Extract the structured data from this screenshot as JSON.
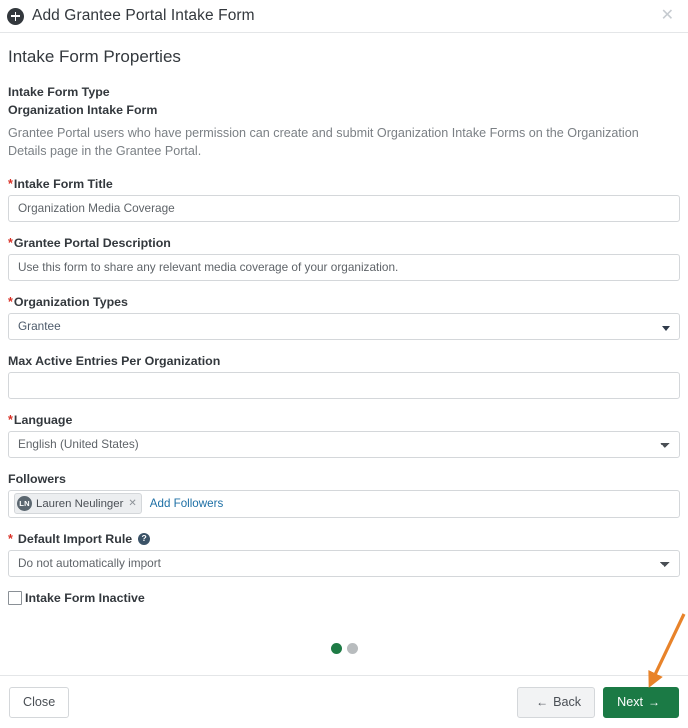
{
  "header": {
    "icon": "add-circle-icon",
    "title": "Add Grantee Portal Intake Form",
    "close_label": "✕"
  },
  "body": {
    "section_title": "Intake Form Properties",
    "intake_form_type": {
      "label": "Intake Form Type",
      "value": "Organization Intake Form",
      "description": "Grantee Portal users who have permission can create and submit Organization Intake Forms on the Organization Details page in the Grantee Portal."
    },
    "fields": {
      "intake_form_title": {
        "label": "Intake Form Title",
        "required": true,
        "required_marker": "*",
        "value": "Organization Media Coverage",
        "placeholder": ""
      },
      "grantee_portal_description": {
        "label": "Grantee Portal Description",
        "required": true,
        "required_marker": "*",
        "value": "Use this form to share any relevant media coverage of your organization.",
        "placeholder": ""
      },
      "organization_types": {
        "label": "Organization Types",
        "required": true,
        "required_marker": "*",
        "value": "Grantee",
        "caret": "caret-down-icon"
      },
      "max_active_entries": {
        "label": "Max Active Entries Per Organization",
        "required": false,
        "value": "",
        "placeholder": ""
      },
      "language": {
        "label": "Language",
        "required": true,
        "required_marker": "*",
        "value": "English (United States)",
        "options": [
          "English (United States)"
        ]
      },
      "followers": {
        "label": "Followers",
        "required": false,
        "chips": [
          {
            "initials": "LN",
            "name": "Lauren Neulinger",
            "remove_label": "✕"
          }
        ],
        "add_link": "Add Followers"
      },
      "default_import_rule": {
        "label": "Default Import Rule",
        "required": true,
        "required_marker": "*",
        "help_icon": "help-circle-icon",
        "help_glyph": "?",
        "value": "Do not automatically import",
        "options": [
          "Do not automatically import"
        ]
      },
      "intake_form_inactive": {
        "label": "Intake Form Inactive",
        "checked": false
      }
    },
    "steps": {
      "total": 2,
      "current": 1,
      "active_color": "#1e7b45",
      "inactive_color": "#b8bcbe"
    }
  },
  "footer": {
    "close_label": "Close",
    "back_label": "Back",
    "back_arrow": "←",
    "next_label": "Next",
    "next_arrow": "→",
    "next_color": "#1b7a45"
  },
  "annotation": {
    "arrow_color": "#e8832a",
    "target": "next-button"
  }
}
